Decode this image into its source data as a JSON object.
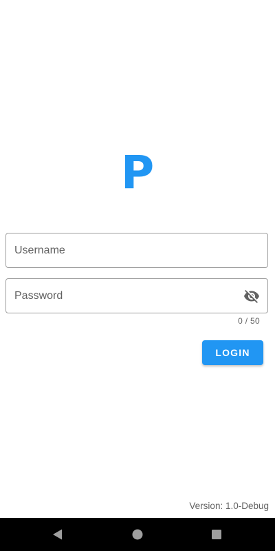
{
  "app": {
    "logo_letter": "P",
    "brand_color": "#2196f3"
  },
  "login_form": {
    "username": {
      "placeholder": "Username",
      "value": ""
    },
    "password": {
      "placeholder": "Password",
      "value": "",
      "visibility_icon": "visibility-off-icon",
      "char_counter": "0 / 50"
    },
    "login_label": "LOGIN"
  },
  "footer": {
    "version": "Version: 1.0-Debug"
  },
  "system_nav": {
    "back_icon": "back-triangle-icon",
    "home_icon": "home-circle-icon",
    "recents_icon": "recents-square-icon"
  }
}
